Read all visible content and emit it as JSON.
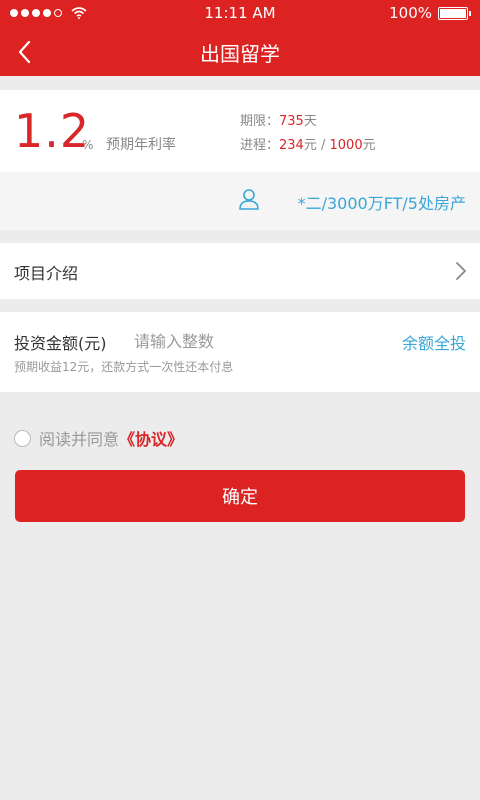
{
  "status_bar": {
    "time": "11:11 AM",
    "battery": "100%",
    "battery_level": 1.0
  },
  "nav": {
    "title": "出国留学",
    "back_icon": "chevron-left-icon"
  },
  "rate": {
    "value": "1.2",
    "unit": "%",
    "label": "预期年利率",
    "term_label": "期限：",
    "term_value": "735",
    "term_unit": "天",
    "progress_label": "进程：",
    "progress_current": "234",
    "progress_current_unit": "元",
    "progress_sep": " / ",
    "progress_total": "1000",
    "progress_total_unit": "元"
  },
  "owner": {
    "icon": "user-icon",
    "text": "*二/3000万FT/5处房产"
  },
  "intro": {
    "label": "项目介绍",
    "icon": "chevron-right-icon"
  },
  "invest": {
    "label": "投资金额(元)",
    "placeholder": "请输入整数",
    "all_in_label": "余额全投",
    "note": "预期收益12元，还款方式一次性还本付息"
  },
  "agreement": {
    "text": "阅读并同意",
    "link": "《协议》"
  },
  "confirm": {
    "label": "确定"
  },
  "colors": {
    "brand": "#dd2222",
    "accent_red": "#d8262b",
    "link_blue": "#3aa6d8"
  }
}
